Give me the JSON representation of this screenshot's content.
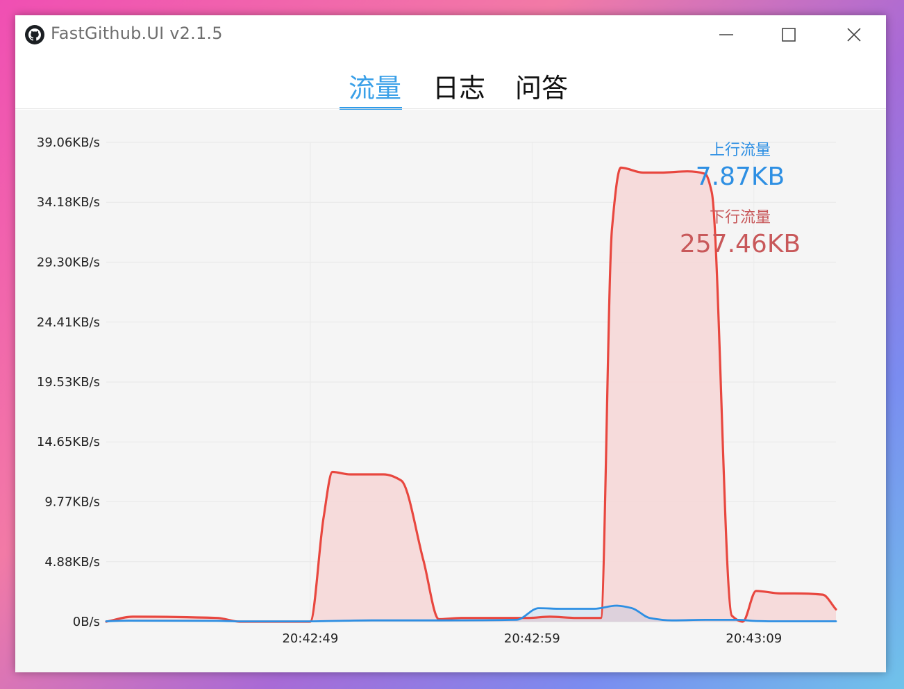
{
  "window": {
    "title": "FastGithub.UI v2.1.5"
  },
  "tabs": [
    {
      "label": "流量",
      "active": true
    },
    {
      "label": "日志",
      "active": false
    },
    {
      "label": "问答",
      "active": false
    }
  ],
  "stats": {
    "upload_label": "上行流量",
    "upload_value": "7.87KB",
    "download_label": "下行流量",
    "download_value": "257.46KB"
  },
  "chart_data": {
    "type": "area",
    "title": "",
    "y_tick_labels": [
      "0B/s",
      "4.88KB/s",
      "9.77KB/s",
      "14.65KB/s",
      "19.53KB/s",
      "24.41KB/s",
      "29.30KB/s",
      "34.18KB/s",
      "39.06KB/s"
    ],
    "y_ticks": [
      0,
      4.88,
      9.77,
      14.65,
      19.53,
      24.41,
      29.3,
      34.18,
      39.06
    ],
    "ylim": [
      0,
      39.06
    ],
    "x_tick_labels": [
      "20:42:49",
      "20:42:59",
      "20:43:09"
    ],
    "x_ticks": [
      9.2,
      19.2,
      29.2
    ],
    "xlim": [
      0,
      32.9
    ],
    "grid": true,
    "colors": {
      "upload": "#2d8fe3",
      "download": "#e8473f",
      "download_fill": "#f6d8d8"
    },
    "series": [
      {
        "name": "上行流量",
        "x": [
          0,
          1,
          5,
          6,
          9,
          12,
          15,
          18.5,
          19.5,
          20.5,
          22,
          23,
          23.7,
          24.5,
          25.5,
          27,
          28.5,
          29.3,
          30,
          32.9
        ],
        "values": [
          0.03,
          0.08,
          0.06,
          0.02,
          0.02,
          0.1,
          0.1,
          0.15,
          1.1,
          1.05,
          1.05,
          1.3,
          1.1,
          0.3,
          0.1,
          0.15,
          0.15,
          0.05,
          0.03,
          0.03
        ]
      },
      {
        "name": "下行流量",
        "x": [
          0,
          1.2,
          5,
          6,
          9.2,
          9.8,
          10.2,
          11,
          12.5,
          13.3,
          14.3,
          15,
          16,
          19,
          20,
          21.2,
          22.3,
          22.8,
          23.2,
          24.2,
          25,
          26.2,
          27,
          27.3,
          28.2,
          28.7,
          29.3,
          30.4,
          31,
          32.3,
          32.9
        ],
        "values": [
          0,
          0.4,
          0.3,
          0,
          0,
          8.5,
          12.2,
          12,
          12,
          11.5,
          5,
          0.2,
          0.3,
          0.3,
          0.4,
          0.3,
          0.3,
          32,
          37,
          36.6,
          36.6,
          36.7,
          36.5,
          35,
          0.5,
          0,
          2.5,
          2.3,
          2.3,
          2.2,
          1.0
        ]
      }
    ]
  }
}
